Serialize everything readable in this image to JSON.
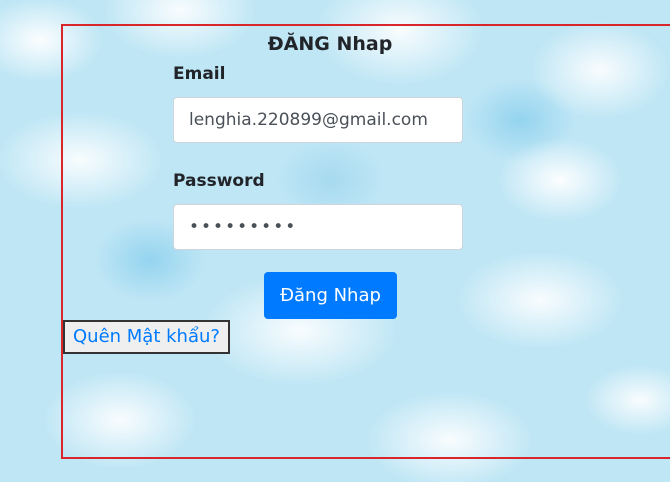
{
  "login": {
    "title": "ĐĂNG Nhap",
    "email_label": "Email",
    "email_value": "lenghia.220899@gmail.com",
    "password_label": "Password",
    "password_value": "•••••••••",
    "submit_label": "Đăng Nhap",
    "forgot_label": "Quên Mật khẩu?"
  },
  "colors": {
    "frame_border": "#d9262a",
    "primary_button": "#007bff",
    "link_text": "#007bff"
  }
}
